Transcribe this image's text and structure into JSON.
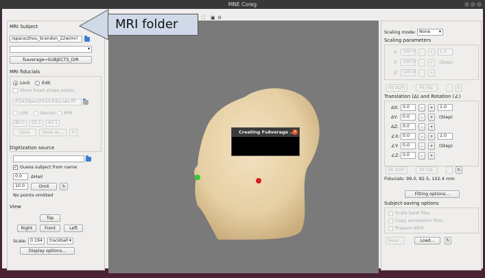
{
  "window": {
    "title": "MNE Coreg"
  },
  "callout": {
    "text": "MRI folder"
  },
  "left": {
    "mri_subject": {
      "section": "MRI Subject",
      "subjects_dir": "/space/zhou_brandon_22w/mri",
      "subject_select": "",
      "fsaverage_button": "fsaverage⇨SUBJECTS_DIR"
    },
    "mri_fiducials": {
      "section": "MRI fiducials",
      "lock": "Lock",
      "edit": "Edit",
      "show_head_shape": "Show head shape points",
      "fid_file": "/FS43/bem/FS43-fiducials.fif",
      "lpa": "LPA",
      "nasion": "Nasion",
      "rpa": "RPA",
      "x": "80.0",
      "y": "25.5",
      "z": "42.1",
      "save": "Save",
      "save_as": "Save as...",
      "reset": "↻"
    },
    "digitization": {
      "section": "Digitization source",
      "file": "",
      "guess_subject": "Guess subject from name",
      "hair_value": "0.0",
      "hair_label": "ΔHair",
      "omit_value": "10.0",
      "omit_button": "Omit",
      "reset": "↻",
      "status": "No points omitted"
    },
    "view": {
      "section": "View",
      "top": "Top",
      "right": "Right",
      "front": "Front",
      "left": "Left",
      "scale_label": "Scale:",
      "scale_value": "0.194",
      "interaction": "trackball",
      "display_options": "Display options..."
    }
  },
  "dialog": {
    "title": "Creating FsAverage ...",
    "close": "×"
  },
  "right": {
    "scaling_mode_label": "Scaling mode:",
    "scaling_mode": "None",
    "scaling_params_section": "Scaling parameters",
    "sx": "X:",
    "sy": "Y:",
    "sz": "Z:",
    "s_value": "100.0",
    "s_step": "1.0",
    "step_label": "(Step)",
    "fit_icp": "Fit (ICP)",
    "fit_fid": "Fit Fid.",
    "trans_section": "Translation (Δ) and Rotation (∠)",
    "dx": "ΔX:",
    "dy": "ΔY:",
    "dz": "ΔZ:",
    "rx": "∠X:",
    "ry": "∠Y:",
    "rz": "∠Z:",
    "zero": "0.0",
    "trans_step": "1.0",
    "rot_step": "1.0",
    "minus": "-",
    "plus": "+",
    "fit_icp2": "Fit (ICP)",
    "fit_fid2": "Fit Fid.",
    "fiducials_readout": "Fiducials: 99.0, 82.5, 102.4 mm",
    "fitting_options": "Fitting options...",
    "saving_section": "Subject-saving options",
    "scale_label_files": "Scale label files",
    "copy_annotation": "Copy annotation files",
    "prepare_bem": "Prepare BEM",
    "save": "Save...",
    "load": "Load...",
    "reset": "↻"
  },
  "colors": {
    "view_bg": "#7a7a7a",
    "head": "#ecd9b6",
    "lpa": "#2ecc2e",
    "nasion": "#d81c1c",
    "accent": "#3a7fd0"
  }
}
